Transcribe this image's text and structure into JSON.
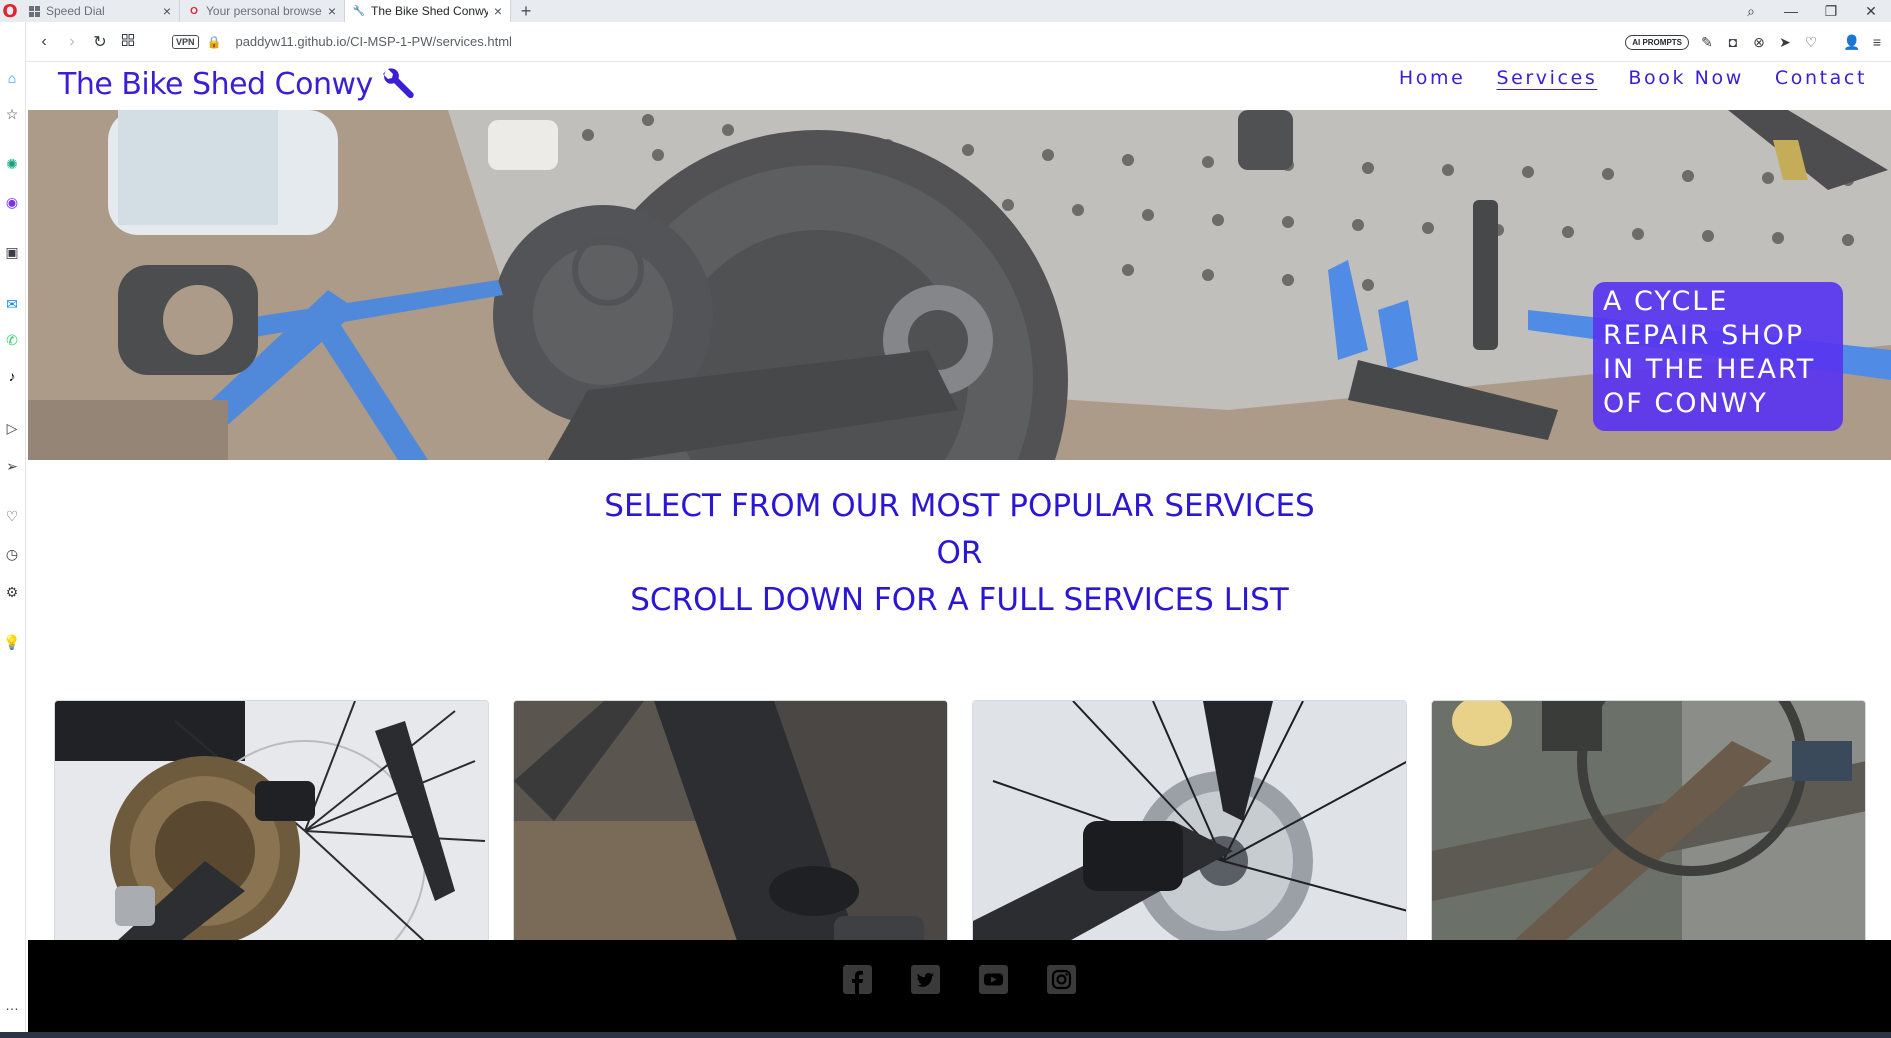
{
  "browser": {
    "tabs": [
      {
        "title": "Speed Dial",
        "active": false
      },
      {
        "title": "Your personal browser is al",
        "active": false
      },
      {
        "title": "The Bike Shed Conwy - Ser",
        "active": true
      }
    ],
    "new_tab": "+",
    "url": "paddyw11.github.io/CI-MSP-1-PW/services.html",
    "vpn_label": "VPN",
    "ai_prompts_label": "AI PROMPTS"
  },
  "site": {
    "logo_text": "The Bike Shed Conwy",
    "brand_color": "#3b1fd6",
    "nav": [
      {
        "label": "Home",
        "current": false
      },
      {
        "label": "Services",
        "current": true
      },
      {
        "label": "Book Now",
        "current": false
      },
      {
        "label": "Contact",
        "current": false
      }
    ],
    "hero_caption": "A CYCLE REPAIR SHOP IN THE HEART OF CONWY",
    "intro_line1": "SELECT FROM OUR MOST POPULAR SERVICES",
    "intro_line2": "OR",
    "intro_line3": "SCROLL DOWN FOR A FULL SERVICES LIST",
    "cards": [
      {
        "image": "rear-cassette-derailleur-photo"
      },
      {
        "image": "suspension-fork-photo"
      },
      {
        "image": "disc-brake-caliper-photo"
      },
      {
        "image": "muddy-frame-photo"
      }
    ],
    "social_icons": [
      "facebook-icon",
      "twitter-icon",
      "youtube-icon",
      "instagram-icon"
    ]
  }
}
